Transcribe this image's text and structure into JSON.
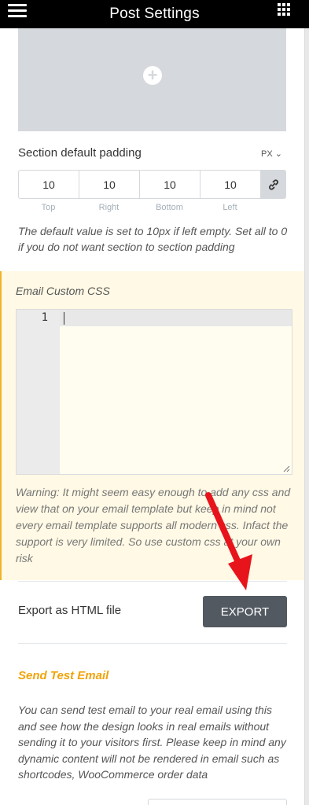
{
  "header": {
    "title": "Post Settings",
    "menu_icon": "hamburger-icon",
    "apps_icon": "grid-apps-icon"
  },
  "image_placeholder": {
    "icon": "plus-circle-icon"
  },
  "padding": {
    "label": "Section default padding",
    "unit": "PX",
    "values": {
      "top": "10",
      "right": "10",
      "bottom": "10",
      "left": "10"
    },
    "labels": {
      "top": "Top",
      "right": "Right",
      "bottom": "Bottom",
      "left": "Left"
    },
    "link_icon": "link-icon",
    "description": "The default value is set to 10px if left empty. Set all to 0 if you do not want section to section padding"
  },
  "custom_css": {
    "title": "Email Custom CSS",
    "line_number": "1",
    "warning": "Warning: It might seem easy enough to add any css and view that on your email template but keep in mind not every email template supports all modern css. Infact the support is very limited. So use custom css at your own risk"
  },
  "export": {
    "label": "Export as HTML file",
    "button": "EXPORT"
  },
  "test_email": {
    "title": "Send Test Email",
    "description": "You can send test email to your real email using this and see how the design looks in real emails without sending it to your visitors first. Please keep in mind any dynamic content will not be rendered in email such as shortcodes, WooCommerce order data"
  },
  "colors": {
    "accent": "#f0a30a",
    "annotation": "#e8141b",
    "button": "#525961",
    "panel_bg": "#fff9e5"
  }
}
